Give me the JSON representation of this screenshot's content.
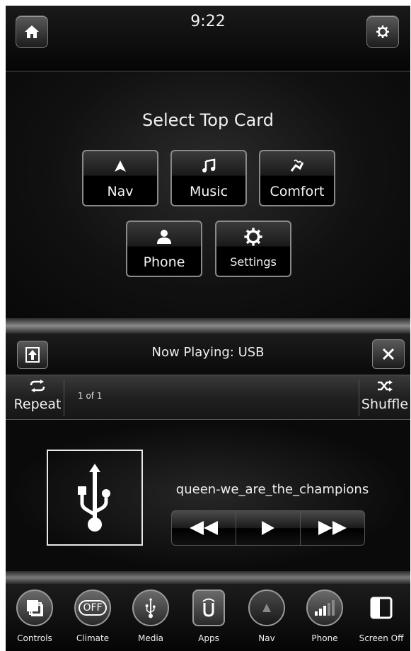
{
  "status": {
    "time": "9:22"
  },
  "topbar": {
    "home_icon": "home-icon",
    "settings_icon": "gear-icon"
  },
  "select_card": {
    "title": "Select Top Card",
    "cards": [
      {
        "label": "Nav",
        "icon": "navigation-arrow-icon"
      },
      {
        "label": "Music",
        "icon": "music-note-icon"
      },
      {
        "label": "Comfort",
        "icon": "seat-climate-icon"
      },
      {
        "label": "Phone",
        "icon": "person-icon"
      },
      {
        "label": "Settings",
        "icon": "gear-icon"
      }
    ]
  },
  "now_playing": {
    "title": "Now Playing: USB",
    "repeat_label": "Repeat",
    "shuffle_label": "Shuffle",
    "count": "1 of 1",
    "track": "queen-we_are_the_champions",
    "source_icon": "usb-icon"
  },
  "dock": {
    "items": [
      {
        "label": "Controls",
        "icon": "controls-icon"
      },
      {
        "label": "Climate",
        "icon": "climate-off-icon",
        "badge": "OFF"
      },
      {
        "label": "Media",
        "icon": "usb-icon"
      },
      {
        "label": "Apps",
        "icon": "apps-icon"
      },
      {
        "label": "Nav",
        "icon": "navigation-arrow-icon"
      },
      {
        "label": "Phone",
        "icon": "signal-bars-icon"
      },
      {
        "label": "Screen Off",
        "icon": "screen-off-icon"
      }
    ]
  }
}
